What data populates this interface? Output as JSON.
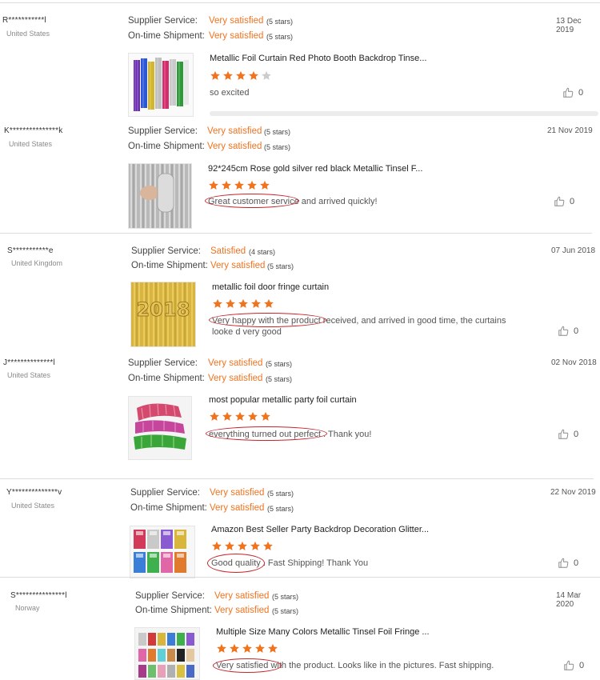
{
  "labels": {
    "supplier_service": "Supplier Service:",
    "on_time_shipment": "On-time Shipment:"
  },
  "colors": {
    "accent": "#f0731f",
    "star_empty": "#cccccc",
    "annotation": "#c8242b"
  },
  "reviews": [
    {
      "user": "R***********l",
      "country": "United States",
      "date": "13 Dec 2019",
      "supplier_value": "Very satisfied",
      "supplier_stars": "(5 stars)",
      "shipment_value": "Very satisfied",
      "shipment_stars": "(5 stars)",
      "product_title": "Metallic Foil Curtain Red Photo Booth Backdrop Tinse...",
      "rating": 4,
      "comment": "so excited",
      "likes": "0",
      "image": "colorful-foil-curtain-image"
    },
    {
      "user": "K***************k",
      "country": "United States",
      "date": "21 Nov 2019",
      "supplier_value": "Very satisfied",
      "supplier_stars": "(5 stars)",
      "shipment_value": "Very satisfied",
      "shipment_stars": "(5 stars)",
      "product_title": "92*245cm Rose gold silver red black Metallic Tinsel F...",
      "rating": 5,
      "comment": "Great customer service and arrived quickly!",
      "likes": "0",
      "image": "silver-foil-curtain-image"
    },
    {
      "user": "S***********e",
      "country": "United Kingdom",
      "date": "07 Jun 2018",
      "supplier_value": "Satisfied",
      "supplier_stars": "(4 stars)",
      "shipment_value": "Very satisfied",
      "shipment_stars": "(5 stars)",
      "product_title": "metallic foil door fringe curtain",
      "rating": 5,
      "comment": "Very happy with the product received, and arrived in good time, the curtains looke d very good",
      "likes": "0",
      "image": "gold-2018-curtain-image"
    },
    {
      "user": "J**************l",
      "country": "United States",
      "date": "02 Nov 2018",
      "supplier_value": "Very satisfied",
      "supplier_stars": "(5 stars)",
      "shipment_value": "Very satisfied",
      "shipment_stars": "(5 stars)",
      "product_title": "most popular metallic party foil curtain",
      "rating": 5,
      "comment": "everything turned out perfect . Thank you!",
      "likes": "0",
      "image": "pink-green-foil-image"
    },
    {
      "user": "Y**************v",
      "country": "United States",
      "date": "22 Nov 2019",
      "supplier_value": "Very satisfied",
      "supplier_stars": "(5 stars)",
      "shipment_value": "Very satisfied",
      "shipment_stars": "(5 stars)",
      "product_title": "Amazon Best Seller Party Backdrop Decoration Glitter...",
      "rating": 5,
      "comment": "Good quality . Fast Shipping! Thank You",
      "likes": "0",
      "image": "packaged-foil-image"
    },
    {
      "user": "S***************l",
      "country": "Norway",
      "date": "14 Mar 2020",
      "supplier_value": "Very satisfied",
      "supplier_stars": "(5 stars)",
      "shipment_value": "Very satisfied",
      "shipment_stars": "(5 stars)",
      "product_title": "Multiple Size Many Colors Metallic Tinsel Foil Fringe ...",
      "rating": 5,
      "comment": "Very satisfied with the product. Looks like in the pictures. Fast shipping.",
      "likes": "0",
      "image": "multicolor-foil-samples-image"
    }
  ]
}
